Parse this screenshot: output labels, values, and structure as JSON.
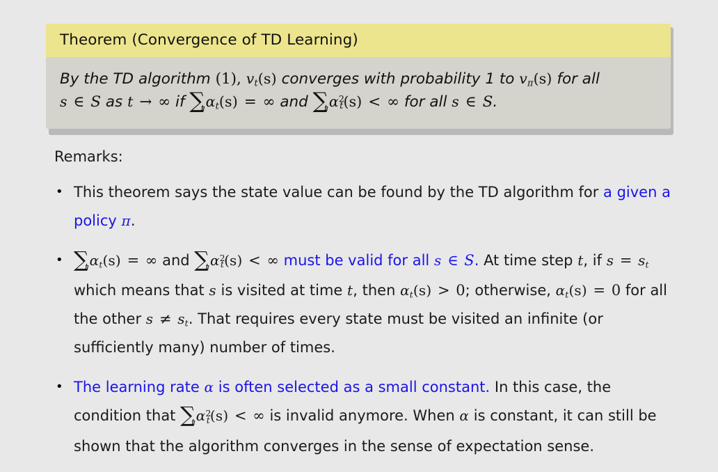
{
  "slide": {
    "background_color": "#e8e8e8",
    "accent_color": "#1b13e8",
    "theorem_title_bg": "#ede58e",
    "theorem_body_bg": "#d4d4cc"
  },
  "theorem": {
    "title": "Theorem (Convergence of TD Learning)",
    "body_line1_a": "By the TD algorithm",
    "body_line1_ref": "(1),",
    "body_line1_v": "v",
    "body_line1_v_sub": "t",
    "body_line1_v_arg": "(s)",
    "body_line1_b": "converges with probability 1 to",
    "body_line1_vpi": "v",
    "body_line1_vpi_sub": "π",
    "body_line1_vpi_arg": "(s)",
    "body_line1_c": "for all",
    "body_line2_s": "s",
    "body_line2_in": "∈",
    "body_line2_S": "S",
    "body_line2_as": "as",
    "body_line2_t": "t",
    "body_line2_arrow": "→",
    "body_line2_inf": "∞",
    "body_line2_if": "if",
    "body_line2_sum1_sub": "t",
    "body_line2_alpha1": "α",
    "body_line2_alpha1_sub": "t",
    "body_line2_alpha1_arg": "(s)",
    "body_line2_eq": "=",
    "body_line2_inf2": "∞",
    "body_line2_and": "and",
    "body_line2_sum2_sub": "t",
    "body_line2_alpha2": "α",
    "body_line2_alpha2_sup": "2",
    "body_line2_alpha2_sub": "t",
    "body_line2_alpha2_arg": "(s)",
    "body_line2_lt": "<",
    "body_line2_inf3": "∞",
    "body_line2_forall": "for all",
    "body_line2_s2": "s",
    "body_line2_in2": "∈",
    "body_line2_S2": "S",
    "body_line2_period": "."
  },
  "remarks": {
    "label": "Remarks:",
    "bullet_marker": "•",
    "items": [
      {
        "id": "remark-theorem-state-value",
        "black_prefix": "This theorem says the state value can be found by the TD algorithm for",
        "blue_text": "a given a policy",
        "blue_symbol": "π",
        "black_suffix": "."
      },
      {
        "id": "remark-stepsize-conditions",
        "math_sum1_sub": "t",
        "math_alpha1": "α",
        "math_alpha1_sub": "t",
        "math_alpha1_arg": "(s)",
        "math_eq": "=",
        "math_inf": "∞",
        "math_and": "and",
        "math_sum2_sub": "t",
        "math_alpha2": "α",
        "math_alpha2_sup": "2",
        "math_alpha2_sub": "t",
        "math_alpha2_arg": "(s)",
        "math_lt": "<",
        "math_inf2": "∞",
        "blue_text": "must be valid for all",
        "blue_s": "s",
        "blue_in": "∈",
        "blue_S": "S",
        "blue_period": ".",
        "rest_1": "At time step",
        "rest_t": "t",
        "rest_2": ", if",
        "rest_s": "s",
        "rest_eq": "=",
        "rest_st": "s",
        "rest_st_sub": "t",
        "rest_3": "which means that",
        "rest_s2": "s",
        "rest_4": "is visited at time",
        "rest_t2": "t",
        "rest_5": ", then",
        "rest_alpha": "α",
        "rest_alpha_sub": "t",
        "rest_alpha_arg": "(s)",
        "rest_gt": ">",
        "rest_zero": "0",
        "rest_6": "; otherwise,",
        "rest_alpha2": "α",
        "rest_alpha2_sub": "t",
        "rest_alpha2_arg": "(s)",
        "rest_eq2": "=",
        "rest_zero2": "0",
        "rest_7": "for all the other",
        "rest_s3": "s",
        "rest_neq": "≠",
        "rest_st2": "s",
        "rest_st2_sub": "t",
        "rest_8": ". That requires every state must be visited an infinite (or sufficiently many) number of times."
      },
      {
        "id": "remark-learning-rate-constant",
        "blue_1": "The learning rate",
        "blue_alpha": "α",
        "blue_2": "is often selected as a small constant.",
        "black_1": "In this case, the condition that",
        "black_sum_sub": "t",
        "black_alpha": "α",
        "black_alpha_sup": "2",
        "black_alpha_sub": "t",
        "black_alpha_arg": "(s)",
        "black_lt": "<",
        "black_inf": "∞",
        "black_2": "is invalid anymore. When",
        "black_alpha2": "α",
        "black_3": "is constant, it can still be shown that the algorithm converges in the sense of expectation sense."
      }
    ]
  }
}
